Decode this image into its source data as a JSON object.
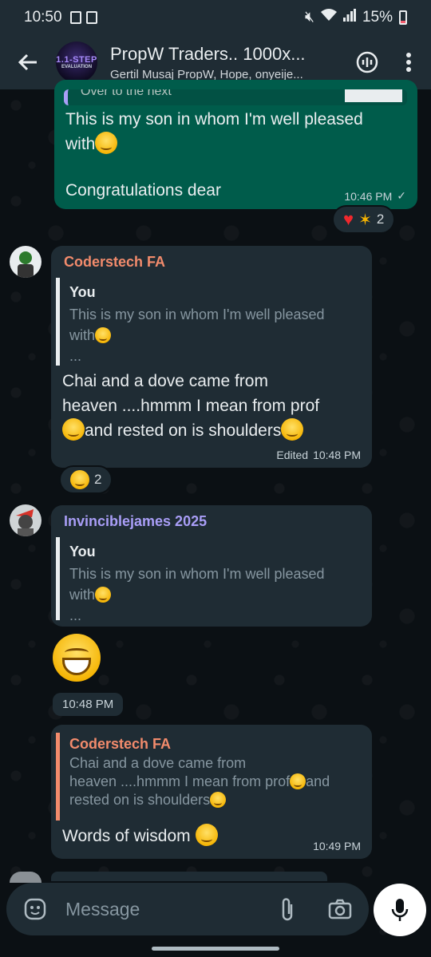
{
  "status_bar": {
    "time": "10:50",
    "battery": "15%"
  },
  "header": {
    "title": "PropW Traders.. 1000x...",
    "subtitle": "Gertil Musaj PropW, Hope, onyeije...",
    "avatar_text_top": "1.1-STEP",
    "avatar_text_bottom": "EVALUATION"
  },
  "messages": [
    {
      "partial_top": "Over to the next",
      "text_line1": "This is my son in whom I'm well pleased",
      "text_line2": "with",
      "text_line3": "Congratulations dear",
      "time": "10:46 PM",
      "reactions_count": "2"
    },
    {
      "sender": "Coderstech FA",
      "sender_color": "#f28b6c",
      "quote_name": "You",
      "quote_line1": "This is my son in whom I'm well pleased",
      "quote_line2": "with",
      "quote_more": "...",
      "text_line1": "Chai and a dove came from",
      "text_line2": "heaven ....hmmm I mean from prof",
      "text_line3": "and rested on is shoulders",
      "edited": "Edited",
      "time": "10:48 PM",
      "reactions_count": "2"
    },
    {
      "sender": "Invinciblejames 2025",
      "sender_color": "#a99ef7",
      "quote_name": "You",
      "quote_line1": "This is my son in whom I'm well pleased",
      "quote_line2": "with",
      "quote_more": "..."
    },
    {
      "time": "10:48 PM"
    },
    {
      "quote_name": "Coderstech FA",
      "quote_line1": "Chai and a dove came from",
      "quote_line2": "heaven ....hmmm I mean from prof",
      "quote_line2b": "and",
      "quote_line3": "rested on is shoulders",
      "text": "Words of wisdom",
      "time": "10:49 PM"
    }
  ],
  "composer": {
    "placeholder": "Message"
  }
}
